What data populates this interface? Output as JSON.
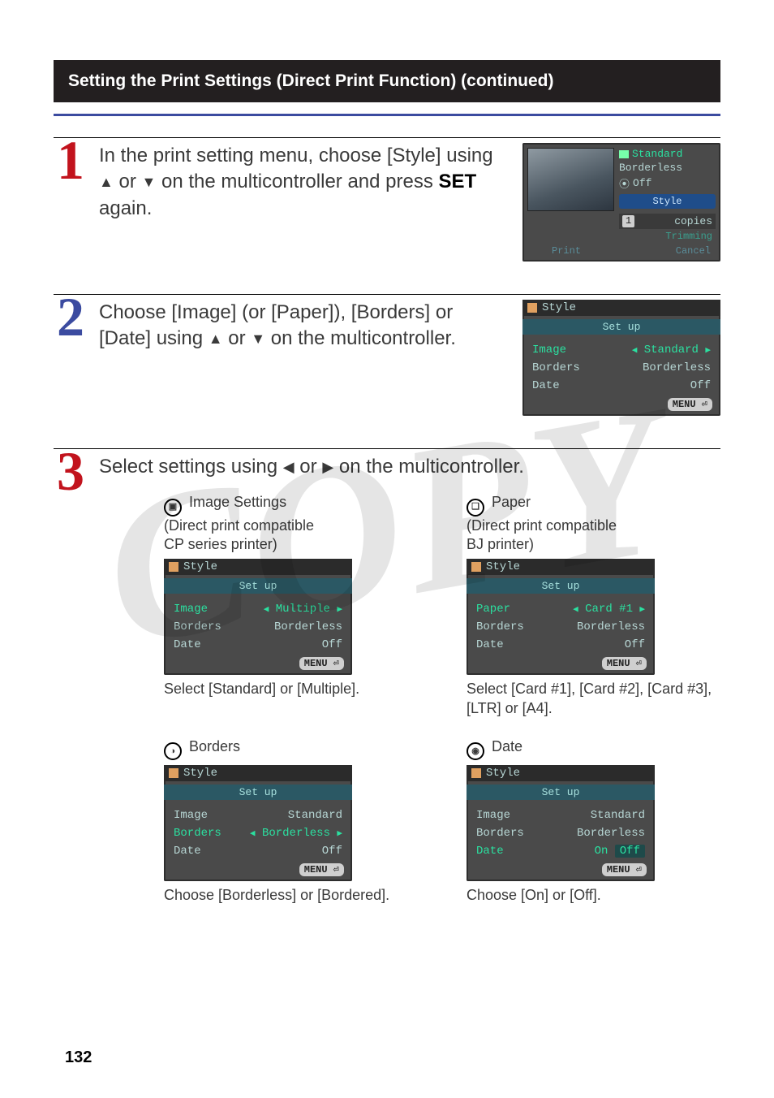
{
  "page_number": "132",
  "watermark": "COPY",
  "section_header": "Setting the Print Settings (Direct Print Function) (continued)",
  "glyphs": {
    "up": "▲",
    "down": "▼",
    "left": "◀",
    "right": "▶"
  },
  "steps": {
    "s1": {
      "num": "1",
      "text_parts": {
        "a": "In the print setting menu, choose [Style] using ",
        "b": " or ",
        "c": " on the multicontroller and press ",
        "set": "SET",
        "d": " again."
      },
      "lcd": {
        "opt_standard": "Standard",
        "opt_borderless": "Borderless",
        "opt_off": "Off",
        "btn_style": "Style",
        "copies_count": "1",
        "copies_label": "copies",
        "trimming": "Trimming",
        "print": "Print",
        "cancel": "Cancel"
      }
    },
    "s2": {
      "num": "2",
      "text_parts": {
        "a": "Choose [Image] (or [Paper]), [Borders] or [Date] using ",
        "b": " or ",
        "c": " on the multicontroller."
      },
      "lcd": {
        "title": "Style",
        "setup": "Set up",
        "rows": {
          "image_lbl": "Image",
          "image_val": "Standard",
          "borders_lbl": "Borders",
          "borders_val": "Borderless",
          "date_lbl": "Date",
          "date_val": "Off"
        },
        "menu_btn": "MENU ⏎"
      }
    },
    "s3": {
      "num": "3",
      "heading_parts": {
        "a": "Select settings using ",
        "b": " or ",
        "c": " on the multicontroller."
      },
      "cells": {
        "image": {
          "top_line1": " Image Settings",
          "top_line2": "(Direct print compatible",
          "top_line3": "CP series printer)",
          "lcd": {
            "title": "Style",
            "setup": "Set up",
            "image_lbl": "Image",
            "image_val": "Multiple",
            "borders_lbl": "Borders",
            "borders_val": "Borderless",
            "date_lbl": "Date",
            "date_val": "Off",
            "menu_btn": "MENU ⏎"
          },
          "bottom": "Select [Standard] or [Multiple]."
        },
        "paper": {
          "top_line1": " Paper",
          "top_line2": "(Direct print compatible",
          "top_line3": "BJ printer)",
          "lcd": {
            "title": "Style",
            "setup": "Set up",
            "paper_lbl": "Paper",
            "paper_val": "Card #1",
            "borders_lbl": "Borders",
            "borders_val": "Borderless",
            "date_lbl": "Date",
            "date_val": "Off",
            "menu_btn": "MENU ⏎"
          },
          "bottom": "Select [Card #1], [Card #2], [Card #3], [LTR] or [A4]."
        },
        "borders": {
          "top_line1": " Borders",
          "lcd": {
            "title": "Style",
            "setup": "Set up",
            "image_lbl": "Image",
            "image_val": "Standard",
            "borders_lbl": "Borders",
            "borders_val": "Borderless",
            "date_lbl": "Date",
            "date_val": "Off",
            "menu_btn": "MENU ⏎"
          },
          "bottom": "Choose [Borderless] or [Bordered]."
        },
        "date": {
          "top_line1": " Date",
          "lcd": {
            "title": "Style",
            "setup": "Set up",
            "image_lbl": "Image",
            "image_val": "Standard",
            "borders_lbl": "Borders",
            "borders_val": "Borderless",
            "date_lbl": "Date",
            "date_on": "On",
            "date_off": "Off",
            "menu_btn": "MENU ⏎"
          },
          "bottom": "Choose [On] or [Off]."
        }
      }
    }
  }
}
